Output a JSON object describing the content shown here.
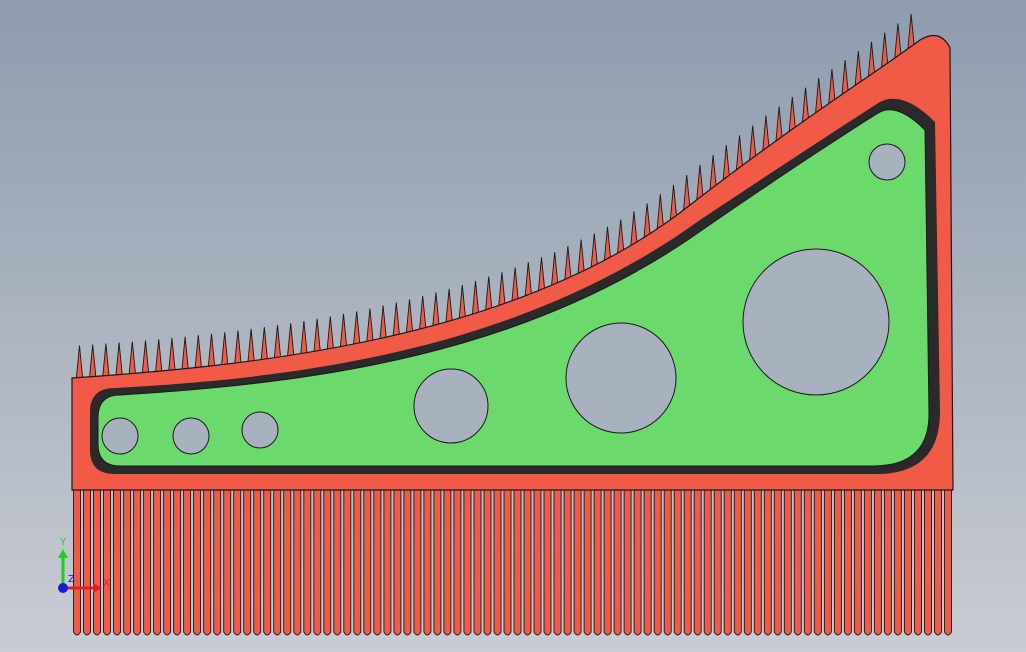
{
  "viewport": {
    "background_top": "#8e9cae",
    "background_bottom": "#c9ccd2"
  },
  "part": {
    "body_color": "#f05a46",
    "pocket_color": "#6cd96c",
    "hole_color": "#a8b2bf",
    "edge_color": "#1a1a1a",
    "shadow_color": "#2a2a2a"
  },
  "triad": {
    "y_label": "Y",
    "x_label": "X",
    "z_label": "Z",
    "y_color": "#1fcf1f",
    "x_color": "#e02020",
    "z_color": "#1a1ad0"
  }
}
